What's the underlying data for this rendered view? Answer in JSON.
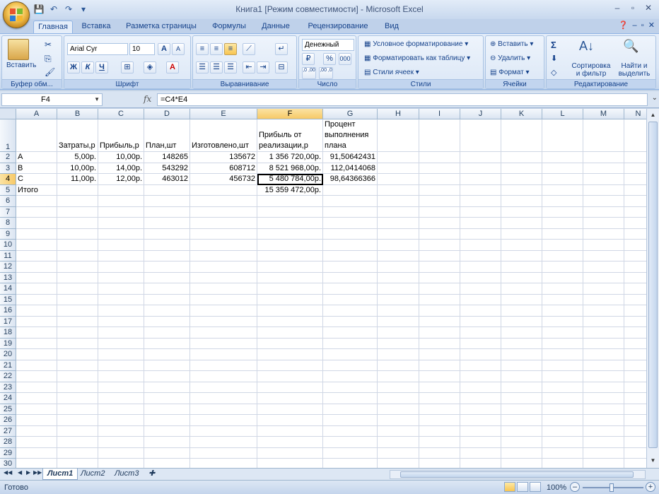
{
  "window": {
    "title": "Книга1  [Режим совместимости] - Microsoft Excel",
    "controls": [
      "–",
      "▫",
      "✕"
    ]
  },
  "ribbon_tabs": [
    "Главная",
    "Вставка",
    "Разметка страницы",
    "Формулы",
    "Данные",
    "Рецензирование",
    "Вид"
  ],
  "ribbon": {
    "clipboard": {
      "paste": "Вставить",
      "label": "Буфер обм..."
    },
    "font": {
      "name": "Arial Cyr",
      "size": "10",
      "bold": "Ж",
      "italic": "К",
      "underline": "Ч",
      "grow": "A",
      "shrink": "A",
      "font_color": "A",
      "label": "Шрифт"
    },
    "alignment": {
      "label": "Выравнивание"
    },
    "number": {
      "format": "Денежный",
      "percent": "%",
      "thousands": "000",
      "inc_dec": ",0 ,00",
      "dec_dec": ",00 ,0",
      "label": "Число"
    },
    "styles": {
      "conditional": "Условное форматирование",
      "as_table": "Форматировать как таблицу",
      "cell_styles": "Стили ячеек",
      "label": "Стили"
    },
    "cells": {
      "insert": "Вставить",
      "delete": "Удалить",
      "format": "Формат",
      "label": "Ячейки"
    },
    "editing": {
      "sigma": "Σ",
      "sort": "Сортировка и фильтр",
      "find": "Найти и выделить",
      "label": "Редактирование"
    }
  },
  "formula_bar": {
    "name_box": "F4",
    "fx": "fx",
    "formula": "=C4*E4"
  },
  "columns": [
    "A",
    "B",
    "C",
    "D",
    "E",
    "F",
    "G",
    "H",
    "I",
    "J",
    "K",
    "L",
    "M",
    "N"
  ],
  "rows": [
    "1",
    "2",
    "3",
    "4",
    "5",
    "6",
    "7",
    "8",
    "9",
    "10",
    "11",
    "12",
    "13",
    "14",
    "15",
    "16",
    "17",
    "18",
    "19",
    "20",
    "21",
    "22",
    "23",
    "24",
    "25",
    "26",
    "27",
    "28",
    "29",
    "30"
  ],
  "cells": {
    "B1": "Затраты,р",
    "C1": "Прибыль,р",
    "D1": "План,шт",
    "E1": "Изготовлено,шт",
    "F1": "Прибыль от реализации,р",
    "G1": "Процент выполнения плана",
    "A2": "A",
    "B2": "5,00р.",
    "C2": "10,00р.",
    "D2": "148265",
    "E2": "135672",
    "F2": "1 356 720,00р.",
    "G2": "91,50642431",
    "A3": "B",
    "B3": "10,00р.",
    "C3": "14,00р.",
    "D3": "543292",
    "E3": "608712",
    "F3": "8 521 968,00р.",
    "G3": "112,0414068",
    "A4": "C",
    "B4": "11,00р.",
    "C4": "12,00р.",
    "D4": "463012",
    "E4": "456732",
    "F4": "5 480 784,00р.",
    "G4": "98,64366366",
    "A5": "Итого",
    "F5": "15 359 472,00р."
  },
  "active_cell": "F4",
  "sheets": [
    "Лист1",
    "Лист2",
    "Лист3"
  ],
  "status": {
    "ready": "Готово",
    "zoom": "100%"
  }
}
